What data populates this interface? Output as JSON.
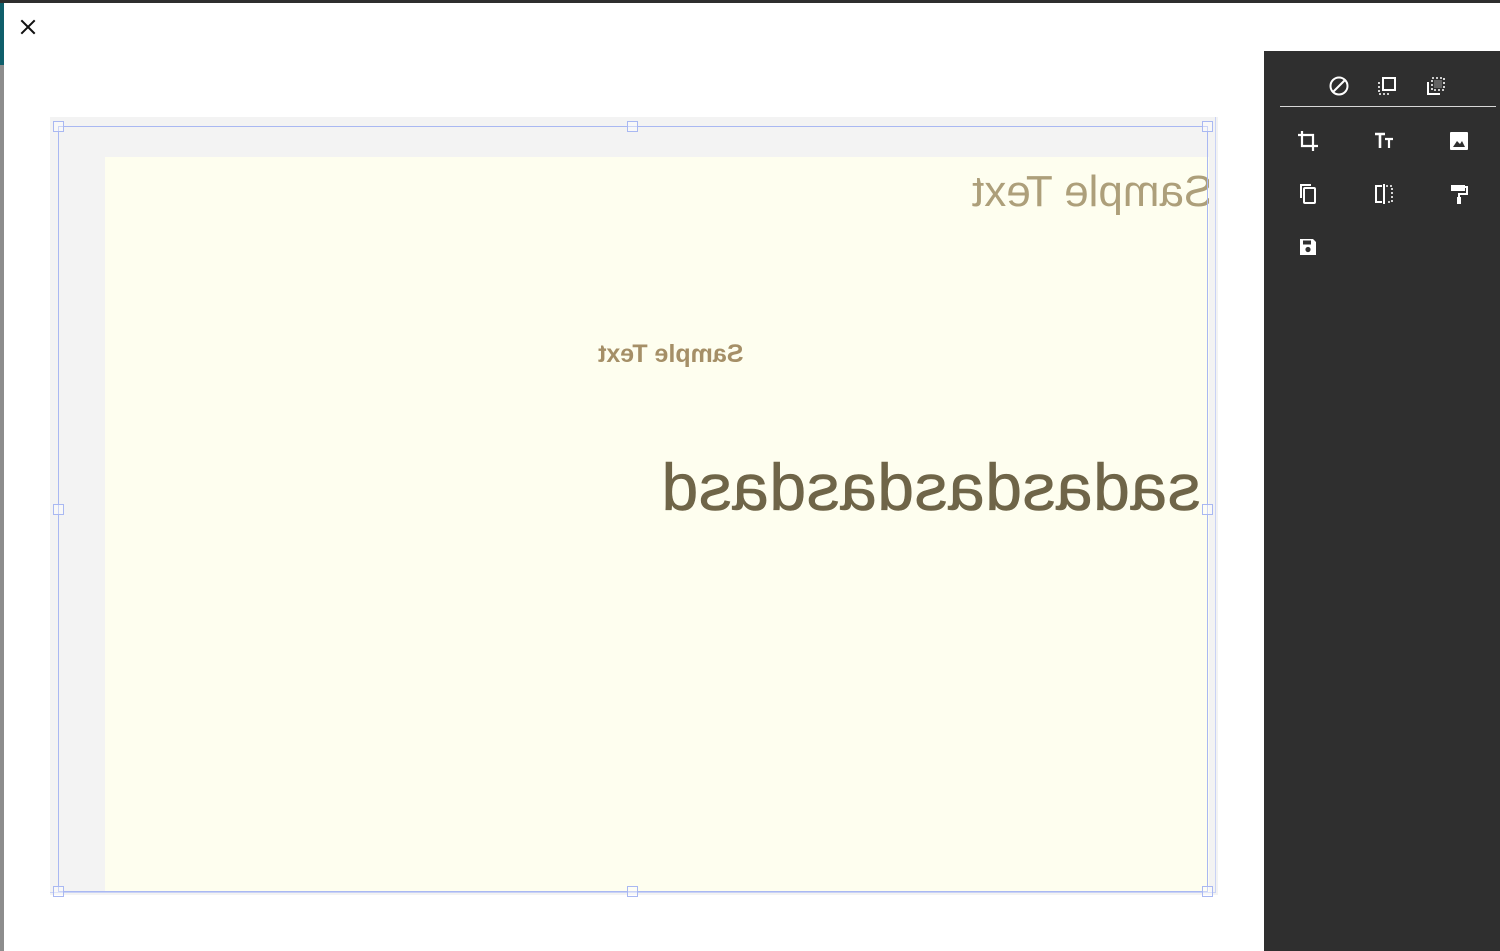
{
  "toolbar": {
    "close_icon": "close-icon",
    "top_row": [
      "no-image-icon",
      "select-front-icon",
      "select-back-icon"
    ],
    "grid": [
      "crop-icon",
      "text-size-icon",
      "image-icon",
      "duplicate-icon",
      "flip-horizontal-icon",
      "format-paint-icon",
      "save-icon"
    ]
  },
  "canvas": {
    "page_background": "#fefeef",
    "texts": [
      {
        "text": "Sample Text",
        "color": "#ad9f7a",
        "mirrored": true
      },
      {
        "text": "Sample Text",
        "color": "#a58f67",
        "mirrored": true
      },
      {
        "text": "sadasdasdasdasd",
        "color": "#6f6548",
        "mirrored": true
      }
    ]
  },
  "colors": {
    "sidebar": "#2f2f2f",
    "selection": "#a9b8f2",
    "stage": "#f3f3f3"
  }
}
